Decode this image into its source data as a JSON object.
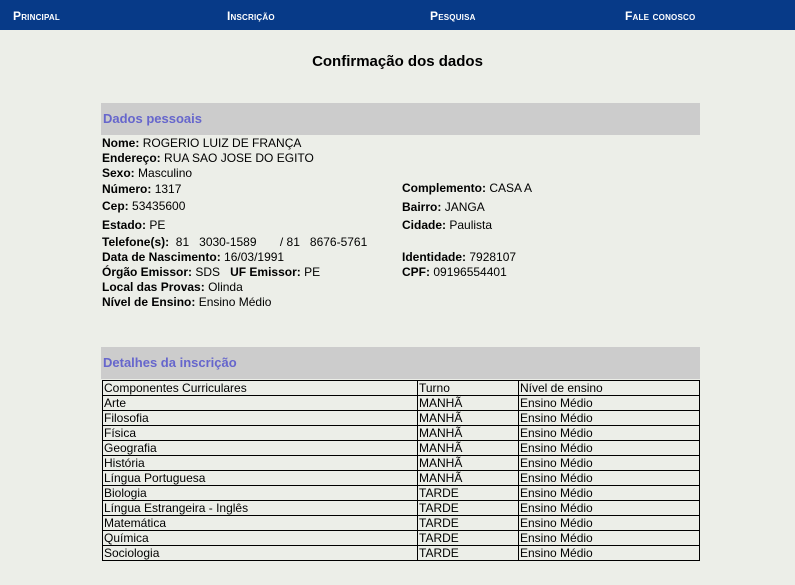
{
  "nav": {
    "items": [
      "Principal",
      "Inscrição",
      "Pesquisa",
      "Fale conosco"
    ]
  },
  "page": {
    "title": "Confirmação dos dados"
  },
  "personal": {
    "header": "Dados pessoais",
    "nome_label": "Nome:",
    "nome": "ROGERIO LUIZ DE FRANÇA",
    "endereco_label": "Endereço:",
    "endereco": "RUA SAO JOSE DO EGITO",
    "sexo_label": "Sexo:",
    "sexo": "Masculino",
    "numero_label": "Número:",
    "numero": "1317",
    "complemento_label": "Complemento:",
    "complemento": "CASA A",
    "cep_label": "Cep:",
    "cep": "53435600",
    "bairro_label": "Bairro:",
    "bairro": "JANGA",
    "estado_label": "Estado:",
    "estado": "PE",
    "cidade_label": "Cidade:",
    "cidade": "Paulista",
    "telefone_label": "Telefone(s):",
    "telefone": "81   3030-1589       / 81   8676-5761",
    "nascimento_label": "Data de Nascimento:",
    "nascimento": "16/03/1991",
    "identidade_label": "Identidade:",
    "identidade": "7928107",
    "orgao_label": "Órgão Emissor:",
    "orgao": "SDS",
    "uf_label": "UF Emissor:",
    "uf": "PE",
    "cpf_label": "CPF:",
    "cpf": "09196554401",
    "local_label": "Local das Provas:",
    "local": "Olinda",
    "nivel_label": "Nível de Ensino:",
    "nivel": "Ensino Médio"
  },
  "details": {
    "header": "Detalhes da inscrição",
    "columns": [
      "Componentes Curriculares",
      "Turno",
      "Nível de ensino"
    ],
    "rows": [
      [
        "Arte",
        "MANHÃ",
        "Ensino Médio"
      ],
      [
        "Filosofia",
        "MANHÃ",
        "Ensino Médio"
      ],
      [
        "Física",
        "MANHÃ",
        "Ensino Médio"
      ],
      [
        "Geografia",
        "MANHÃ",
        "Ensino Médio"
      ],
      [
        "História",
        "MANHÃ",
        "Ensino Médio"
      ],
      [
        "Língua Portuguesa",
        "MANHÃ",
        "Ensino Médio"
      ],
      [
        "Biologia",
        "TARDE",
        "Ensino Médio"
      ],
      [
        "Língua Estrangeira - Inglês",
        "TARDE",
        "Ensino Médio"
      ],
      [
        "Matemática",
        "TARDE",
        "Ensino Médio"
      ],
      [
        "Química",
        "TARDE",
        "Ensino Médio"
      ],
      [
        "Sociologia",
        "TARDE",
        "Ensino Médio"
      ]
    ]
  },
  "colors": {
    "nav_bg": "#073a88",
    "section_bg": "#cccccc",
    "section_text": "#6666cc",
    "page_bg": "#eceee8"
  }
}
